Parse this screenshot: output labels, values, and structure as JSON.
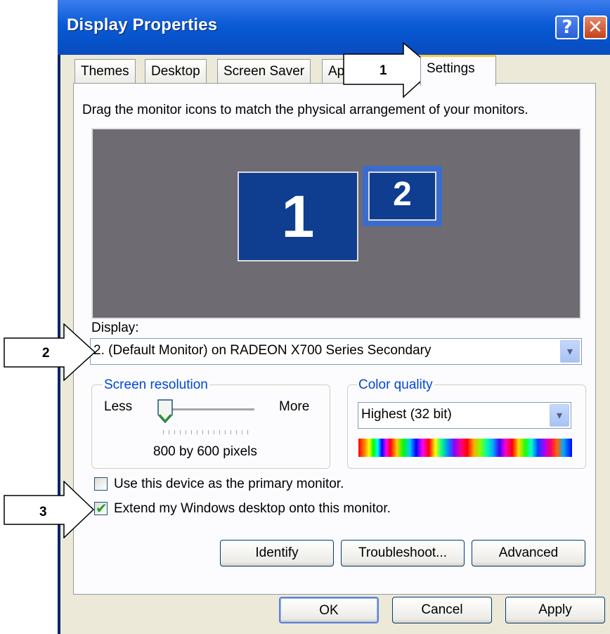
{
  "window": {
    "title": "Display Properties",
    "help_glyph": "?",
    "close_glyph": "✕"
  },
  "tabs": [
    {
      "label": "Themes"
    },
    {
      "label": "Desktop"
    },
    {
      "label": "Screen Saver"
    },
    {
      "label": "Ap"
    },
    {
      "label": "Settings",
      "active": true
    }
  ],
  "settings": {
    "instruction": "Drag the monitor icons to match the physical arrangement of your monitors.",
    "monitors": [
      {
        "number": "1"
      },
      {
        "number": "2",
        "selected": true
      }
    ],
    "display_label": "Display:",
    "display_value": "2. (Default Monitor) on RADEON X700 Series Secondary",
    "resolution": {
      "group_title": "Screen resolution",
      "less_label": "Less",
      "more_label": "More",
      "value_text": "800 by 600 pixels",
      "slider_fraction": 0.0
    },
    "color_quality": {
      "group_title": "Color quality",
      "value": "Highest (32 bit)"
    },
    "primary_monitor_label": "Use this device as the primary monitor.",
    "primary_monitor_checked": false,
    "extend_desktop_label": "Extend my Windows desktop onto this monitor.",
    "extend_desktop_checked": true,
    "buttons": {
      "identify": "Identify",
      "troubleshoot": "Troubleshoot...",
      "advanced": "Advanced"
    }
  },
  "footer": {
    "ok": "OK",
    "cancel": "Cancel",
    "apply": "Apply"
  },
  "callouts": [
    "1",
    "2",
    "3"
  ],
  "colors": {
    "titlebar_blue": "#0a5ad6",
    "dialog_bg": "#ece9d8",
    "monitor_blue": "#0f3d8f",
    "group_title_blue": "#0046d5",
    "check_green": "#21a121"
  }
}
